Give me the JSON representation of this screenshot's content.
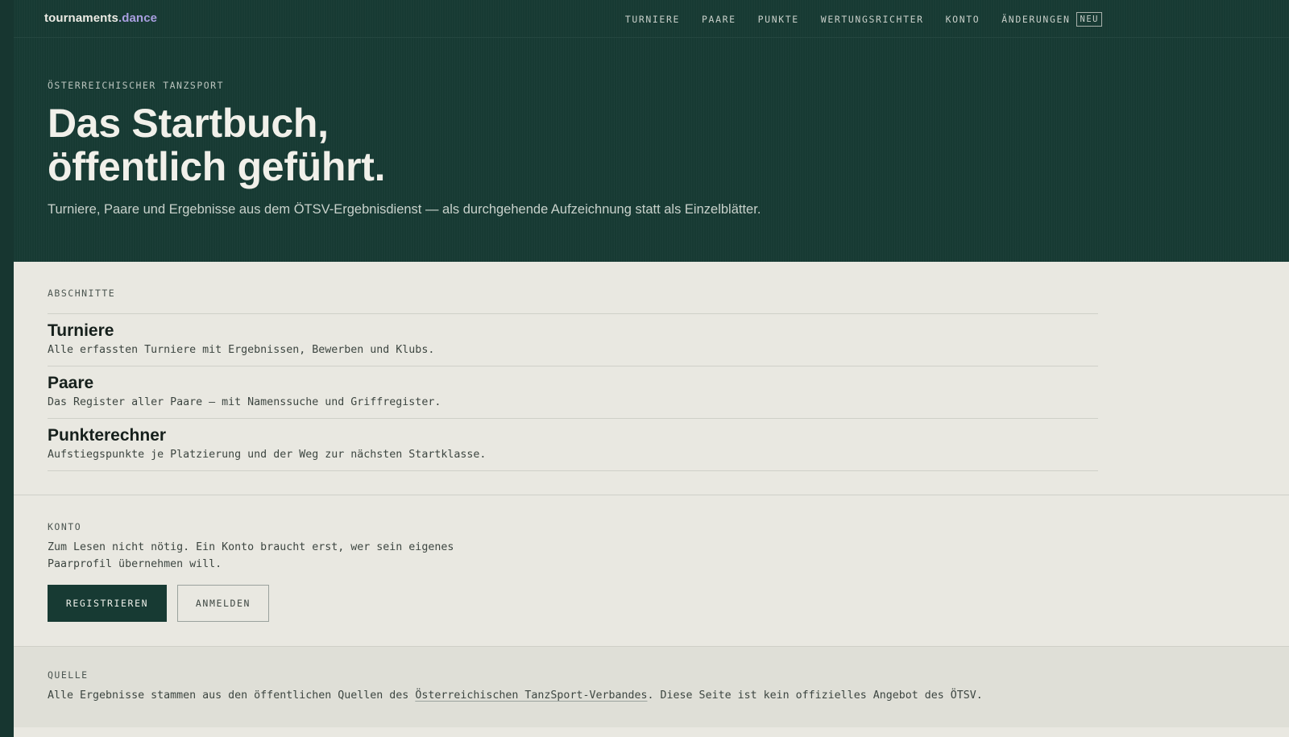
{
  "nav": {
    "brand_name": "tournaments",
    "brand_tld": ".dance",
    "links": [
      {
        "label": "TURNIERE"
      },
      {
        "label": "PAARE"
      },
      {
        "label": "PUNKTE"
      },
      {
        "label": "WERTUNGSRICHTER"
      },
      {
        "label": "KONTO"
      },
      {
        "label": "ÄNDERUNGEN",
        "badge": "NEU"
      }
    ]
  },
  "hero": {
    "eyebrow": "ÖSTERREICHISCHER TANZSPORT",
    "title_line1": "Das Startbuch,",
    "title_line2": "öffentlich geführt.",
    "subtitle": "Turniere, Paare und Ergebnisse aus dem ÖTSV-Ergebnisdienst — als durchgehende Aufzeichnung statt als Einzelblätter."
  },
  "sections": {
    "label": "ABSCHNITTE",
    "items": [
      {
        "title": "Turniere",
        "description": "Alle erfassten Turniere mit Ergebnissen, Bewerben und Klubs."
      },
      {
        "title": "Paare",
        "description": "Das Register aller Paare — mit Namenssuche und Griffregister."
      },
      {
        "title": "Punkterechner",
        "description": "Aufstiegspunkte je Platzierung und der Weg zur nächsten Startklasse."
      }
    ]
  },
  "konto": {
    "label": "KONTO",
    "text": "Zum Lesen nicht nötig. Ein Konto braucht erst, wer sein eigenes Paarprofil übernehmen will.",
    "register_label": "REGISTRIEREN",
    "login_label": "ANMELDEN"
  },
  "quelle": {
    "label": "QUELLE",
    "text_before": "Alle Ergebnisse stammen aus den öffentlichen Quellen des ",
    "link_text": "Österreichischen TanzSport-Verbandes",
    "text_after": ". Diese Seite ist kein offizielles Angebot des ÖTSV."
  },
  "colors": {
    "primary_dark": "#173a33",
    "background": "#e9e8e1",
    "accent_tld": "#a99fe0"
  }
}
